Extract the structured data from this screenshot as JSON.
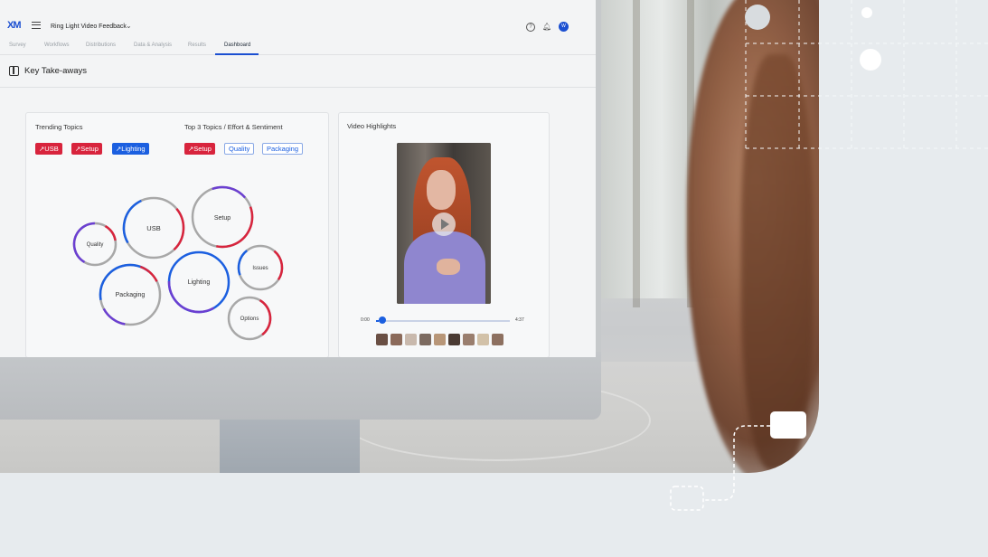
{
  "app": {
    "logo": "XM",
    "project_title": "Ring Light Video Feedback",
    "avatar_initial": "W"
  },
  "tabs": [
    {
      "label": "Survey"
    },
    {
      "label": "Workflows"
    },
    {
      "label": "Distributions"
    },
    {
      "label": "Data & Analysis"
    },
    {
      "label": "Results"
    },
    {
      "label": "Dashboard"
    }
  ],
  "page": {
    "heading": "Key Take-aways"
  },
  "trending": {
    "title": "Trending Topics",
    "tags": [
      {
        "label": "↗USB",
        "color": "red"
      },
      {
        "label": "↗Setup",
        "color": "red"
      },
      {
        "label": "↗Lighting",
        "color": "blue"
      }
    ]
  },
  "top3": {
    "title": "Top 3 Topics / Effort & Sentiment",
    "tags": [
      {
        "label": "↗Setup",
        "style": "red"
      },
      {
        "label": "Quality",
        "style": "outline"
      },
      {
        "label": "Packaging",
        "style": "outline"
      }
    ]
  },
  "bubbles": [
    {
      "label": "Quality"
    },
    {
      "label": "USB"
    },
    {
      "label": "Setup"
    },
    {
      "label": "Issues"
    },
    {
      "label": "Packaging"
    },
    {
      "label": "Lighting"
    },
    {
      "label": "Options"
    }
  ],
  "video": {
    "title": "Video Highlights",
    "time_start": "0:00",
    "time_end": "4:37",
    "progress": 0.02
  },
  "colors": {
    "accent_blue": "#1b5fe0",
    "accent_red": "#d8243d",
    "ring_purple": "#6b3fd1",
    "ring_gray": "#a8a8a8",
    "background": "#e7ebee"
  }
}
